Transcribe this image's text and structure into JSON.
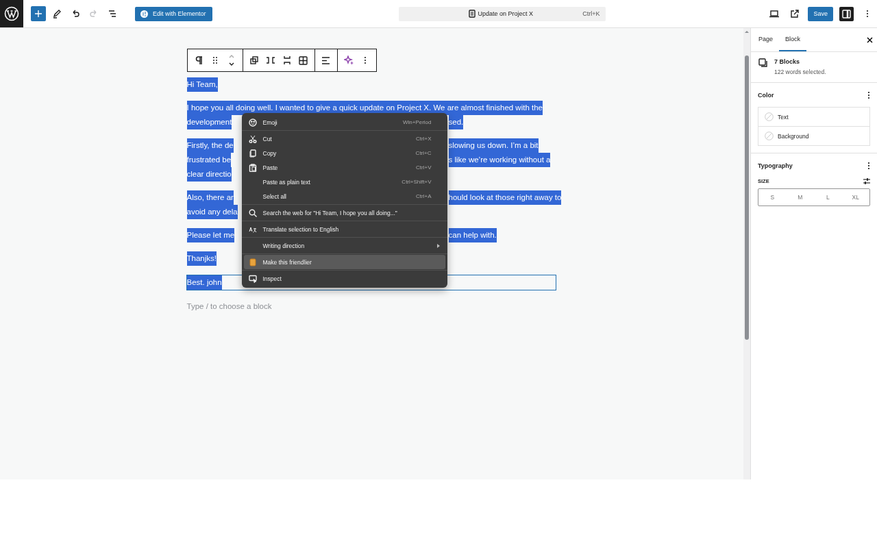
{
  "top_bar": {
    "tools": [
      {
        "kind": "add",
        "pressed": true,
        "disabled": false
      },
      {
        "kind": "edit",
        "pressed": false,
        "disabled": false
      },
      {
        "kind": "undo",
        "pressed": false,
        "disabled": false
      },
      {
        "kind": "redo",
        "pressed": false,
        "disabled": true
      },
      {
        "kind": "list",
        "pressed": false,
        "disabled": false
      }
    ],
    "elementor_button": "Edit with Elementor",
    "command_bar": {
      "title": "Update on Project X",
      "shortcut": "Ctrl+K"
    },
    "save_button": "Save",
    "settings_toggle": {
      "pressed": true
    }
  },
  "editor": {
    "paragraphs": [
      {
        "selected": true,
        "current": false,
        "lines": [
          {
            "left": "Hi Team,"
          }
        ]
      },
      {
        "selected": true,
        "current": false,
        "lines": [
          {
            "left": "I hope you all doing well. I wanted to give a quick update on Project X. We are almost finished with the"
          },
          {
            "left": "development",
            "right": "sed."
          }
        ]
      },
      {
        "selected": true,
        "current": false,
        "lines": [
          {
            "left": "Firstly, the de",
            "right": "slowing us down. I’m a bit"
          },
          {
            "left": "frustrated be",
            "right": "s like we’re working without a"
          },
          {
            "left": "clear directio"
          }
        ]
      },
      {
        "selected": true,
        "current": false,
        "lines": [
          {
            "left": "Also, there ar",
            "right": "hould look at those right away to"
          },
          {
            "left": "avoid any dela"
          }
        ]
      },
      {
        "selected": true,
        "current": false,
        "lines": [
          {
            "left": "Please let me",
            "right": "can help with."
          }
        ]
      },
      {
        "selected": true,
        "current": false,
        "lines": [
          {
            "left": "Thanjks!"
          }
        ]
      },
      {
        "selected": true,
        "current": true,
        "lines": [
          {
            "left": "Best. john"
          }
        ]
      }
    ],
    "placeholder": "Type / to choose a block"
  },
  "context_menu": {
    "groups": [
      [
        {
          "kind": "emoji",
          "label": "Emoji",
          "shortcut": "Win+Period",
          "selected": false
        }
      ],
      [
        {
          "kind": "cut",
          "label": "Cut",
          "shortcut": "Ctrl+X",
          "selected": false
        },
        {
          "kind": "copy",
          "label": "Copy",
          "shortcut": "Ctrl+C",
          "selected": false
        },
        {
          "kind": "paste",
          "label": "Paste",
          "shortcut": "Ctrl+V",
          "selected": false
        },
        {
          "kind": "plain",
          "label": "Paste as plain text",
          "shortcut": "Ctrl+Shift+V",
          "selected": false
        },
        {
          "kind": "plain",
          "label": "Select all",
          "shortcut": "Ctrl+A",
          "selected": false
        }
      ],
      [
        {
          "kind": "search",
          "label": "Search the web for \"Hi Team,  I hope you all doing...\"",
          "selected": false
        }
      ],
      [
        {
          "kind": "translate",
          "label": "Translate selection to English",
          "selected": false
        }
      ],
      [
        {
          "kind": "submenu",
          "label": "Writing direction",
          "selected": false
        }
      ],
      [
        {
          "kind": "assistant",
          "label": "Make this friendlier",
          "selected": true
        }
      ],
      [
        {
          "kind": "inspect",
          "label": "Inspect",
          "selected": false
        }
      ]
    ]
  },
  "sidebar": {
    "tabs": [
      {
        "label": "Page",
        "selected": false
      },
      {
        "label": "Block",
        "selected": true
      }
    ],
    "block_card": {
      "title": "7 Blocks",
      "description": "122 words selected."
    },
    "color": {
      "heading": "Color",
      "items": [
        "Text",
        "Background"
      ]
    },
    "typography": {
      "heading": "Typography",
      "size_label": "SIZE",
      "sizes": [
        {
          "label": "S",
          "selected": false
        },
        {
          "label": "M",
          "selected": false
        },
        {
          "label": "L",
          "selected": false
        },
        {
          "label": "XL",
          "selected": false
        }
      ]
    }
  }
}
